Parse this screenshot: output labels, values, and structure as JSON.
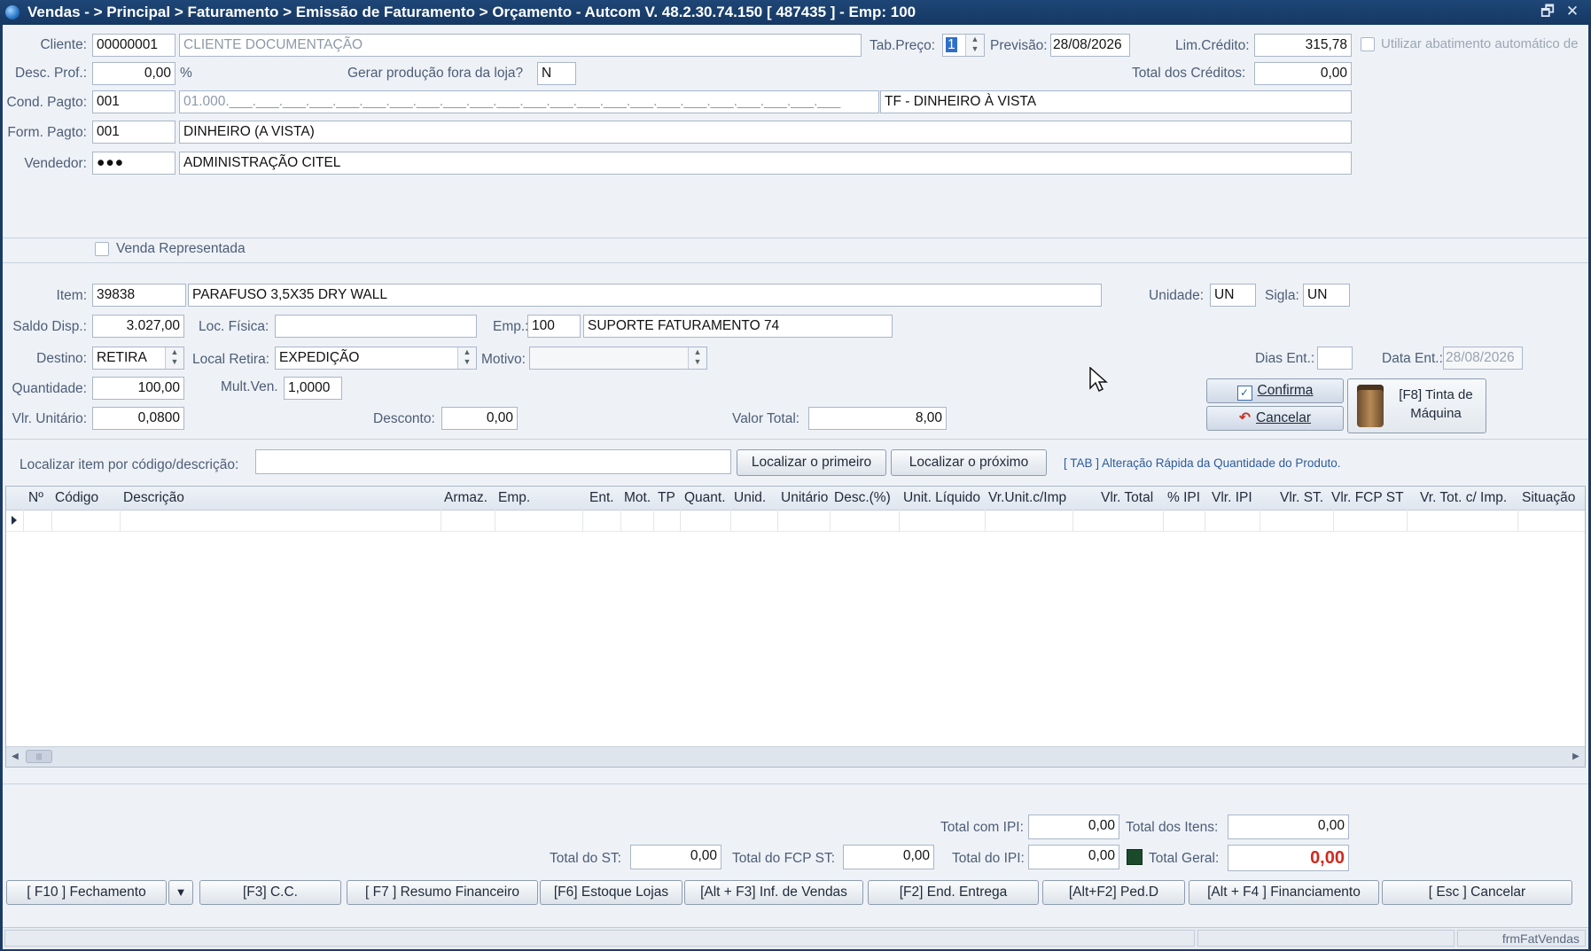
{
  "window": {
    "title": "Vendas -  > Principal > Faturamento > Emissão de Faturamento > Orçamento   -   Autcom V. 48.2.30.74.150 [ 487435 ] - Emp: 100",
    "restore_glyph": "🗗",
    "close_glyph": "✕"
  },
  "header": {
    "cliente_label": "Cliente:",
    "cliente_code": "00000001",
    "cliente_name": "CLIENTE DOCUMENTAÇÃO",
    "tab_preco_label": "Tab.Preço:",
    "tab_preco_value": "1",
    "previsao_label": "Previsão:",
    "previsao_value": "28/08/2026",
    "lim_credito_label": "Lim.Crédito:",
    "lim_credito_value": "315,78",
    "abatimento_label": "Utilizar abatimento automático de",
    "desc_prof_label": "Desc. Prof.:",
    "desc_prof_value": "0,00",
    "percent_sign": "%",
    "gerar_producao_label": "Gerar produção fora da loja?",
    "gerar_producao_value": "N",
    "total_creditos_label": "Total dos Créditos:",
    "total_creditos_value": "0,00",
    "cond_pagto_label": "Cond. Pagto:",
    "cond_pagto_code": "001",
    "cond_pagto_mask": "01.000.___.___.___.___.___.___.___.___.___.___.___.___.___.___.___.___.___.___.___.___.___.___.___",
    "cond_pagto_desc": "TF - DINHEIRO À VISTA",
    "form_pagto_label": "Form. Pagto:",
    "form_pagto_code": "001",
    "form_pagto_desc": "DINHEIRO (A VISTA)",
    "vendedor_label": "Vendedor:",
    "vendedor_code": "●●●",
    "vendedor_name": "ADMINISTRAÇÃO CITEL",
    "venda_representada_label": "Venda Representada"
  },
  "item": {
    "item_label": "Item:",
    "item_code": "39838",
    "item_desc": "PARAFUSO 3,5X35 DRY WALL",
    "unidade_label": "Unidade:",
    "unidade_value": "UN",
    "sigla_label": "Sigla:",
    "sigla_value": "UN",
    "saldo_label": "Saldo Disp.:",
    "saldo_value": "3.027,00",
    "loc_fisica_label": "Loc. Física:",
    "loc_fisica_value": "",
    "emp_label": "Emp.:",
    "emp_code": "100",
    "emp_name": "SUPORTE FATURAMENTO 74",
    "destino_label": "Destino:",
    "destino_value": "RETIRA",
    "local_retira_label": "Local Retira:",
    "local_retira_value": "EXPEDIÇÃO",
    "motivo_label": "Motivo:",
    "motivo_value": "",
    "dias_ent_label": "Dias Ent.:",
    "dias_ent_value": "",
    "data_ent_label": "Data Ent.:",
    "data_ent_value": "28/08/2026",
    "quantidade_label": "Quantidade:",
    "quantidade_value": "100,00",
    "mult_ven_label": "Mult.Ven.",
    "mult_ven_value": "1,0000",
    "vlr_unitario_label": "Vlr. Unitário:",
    "vlr_unitario_value": "0,0800",
    "desconto_label": "Desconto:",
    "desconto_value": "0,00",
    "valor_total_label": "Valor Total:",
    "valor_total_value": "8,00",
    "confirma_label": "Confirma",
    "cancelar_label": "Cancelar",
    "tinta_label_1": "[F8] Tinta de",
    "tinta_label_2": "Máquina"
  },
  "search": {
    "label": "Localizar item por código/descrição:",
    "value": "",
    "first_button": "Localizar o primeiro",
    "next_button": "Localizar o próximo",
    "hint": "[ TAB ] Alteração Rápida da Quantidade do Produto."
  },
  "grid": {
    "columns": [
      "Nº",
      "Código",
      "Descrição",
      "Armaz.",
      "Emp.",
      "Ent.",
      "Mot.",
      "TP",
      "Quant.",
      "Unid.",
      "Unitário",
      "Desc.(%)",
      "Unit. Líquido",
      "Vr.Unit.c/Imp",
      "Vlr. Total",
      "% IPI",
      "Vlr. IPI",
      "Vlr. ST.",
      "Vlr. FCP ST",
      "Vr. Tot. c/ Imp.",
      "Situação"
    ]
  },
  "totals": {
    "total_com_ipi_label": "Total com IPI:",
    "total_com_ipi_value": "0,00",
    "total_itens_label": "Total dos Itens:",
    "total_itens_value": "0,00",
    "total_st_label": "Total do ST:",
    "total_st_value": "0,00",
    "total_fcp_st_label": "Total do FCP ST:",
    "total_fcp_st_value": "0,00",
    "total_ipi_label": "Total do IPI:",
    "total_ipi_value": "0,00",
    "total_geral_label": "Total Geral:",
    "total_geral_value": "0,00",
    "total_geral_color": "#d12a1f"
  },
  "actions": {
    "fechamento": "[ F10 ] Fechamento",
    "cc": "[F3] C.C.",
    "resumo": "[ F7 ] Resumo Financeiro",
    "estoque": "[F6] Estoque Lojas",
    "inf_vendas": "[Alt + F3] Inf. de Vendas",
    "end_entrega": "[F2] End. Entrega",
    "ped_d": "[Alt+F2] Ped.D",
    "financiamento": "[Alt + F4 ] Financiamento",
    "cancelar": "[ Esc ] Cancelar"
  },
  "status": {
    "form_name": "frmFatVendas"
  }
}
